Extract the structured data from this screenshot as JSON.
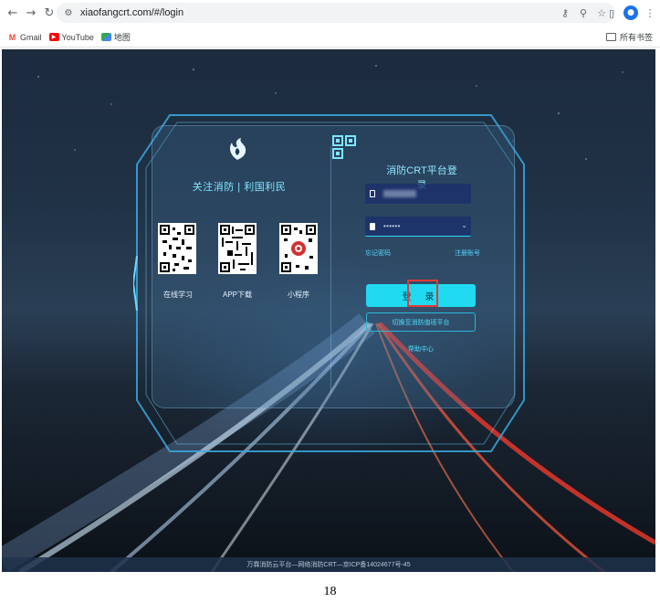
{
  "browser": {
    "url": "xiaofangcrt.com/#/login",
    "bookmarks": [
      {
        "label": "Gmail",
        "icon": "gmail-icon"
      },
      {
        "label": "YouTube",
        "icon": "youtube-icon"
      },
      {
        "label": "地图",
        "icon": "maps-icon"
      }
    ],
    "all_bookmarks_label": "所有书签",
    "accent": "#1a73e8"
  },
  "page": {
    "slogan": "关注消防 | 利国利民",
    "qr_codes": [
      {
        "caption": "在线学习"
      },
      {
        "caption": "APP下载"
      },
      {
        "caption": "小程序"
      }
    ],
    "login": {
      "title": "消防CRT平台登录",
      "password_mask": "••••••",
      "forgot_password": "忘记密码",
      "register": "注册账号",
      "login_button": "登 录",
      "switch_button": "切换至消防值班平台",
      "help": "帮助中心"
    },
    "footer": "万霖消防云平台—网络消防CRT—京ICP备14024677号-45",
    "accent_cyan": "#1fdaf0",
    "highlight_red": "#e53935"
  },
  "document": {
    "page_number": "18"
  }
}
